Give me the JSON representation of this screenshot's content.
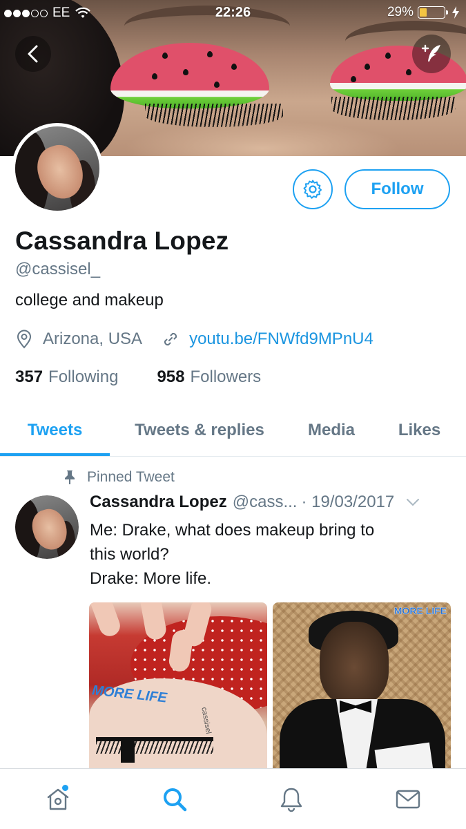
{
  "status_bar": {
    "carrier": "EE",
    "time": "22:26",
    "battery": "29%",
    "battery_level": 0.29,
    "signal_bars": 3
  },
  "colors": {
    "accent": "#1da1f2",
    "link": "#1b95e0",
    "secondary_text": "#657786",
    "primary_text": "#14171a"
  },
  "profile": {
    "name": "Cassandra Lopez",
    "handle": "@cassisel_",
    "bio": "college and makeup",
    "location": "Arizona, USA",
    "link": "youtu.be/FNWfd9MPnU4",
    "following_count": "357",
    "following_label": "Following",
    "followers_count": "958",
    "followers_label": "Followers",
    "follow_label": "Follow"
  },
  "tabs": [
    {
      "label": "Tweets",
      "active": true
    },
    {
      "label": "Tweets & replies",
      "active": false
    },
    {
      "label": "Media",
      "active": false
    },
    {
      "label": "Likes",
      "active": false
    }
  ],
  "tweet": {
    "pinned_label": "Pinned Tweet",
    "author_name": "Cassandra Lopez",
    "author_handle": "@cass...",
    "date": "· 19/03/2017",
    "text_line1": "Me: Drake, what does makeup bring to",
    "text_line2": "this world?",
    "text_line3": "Drake: More life.",
    "media_left_caption": "MORE LIFE",
    "media_left_signature": "cassisel",
    "media_right_caption": "MORE LIFE"
  },
  "bottom_nav": [
    {
      "icon": "home-icon",
      "active": false,
      "has_notification_dot": true
    },
    {
      "icon": "search-icon",
      "active": true
    },
    {
      "icon": "bell-icon",
      "active": false
    },
    {
      "icon": "mail-icon",
      "active": false
    }
  ]
}
